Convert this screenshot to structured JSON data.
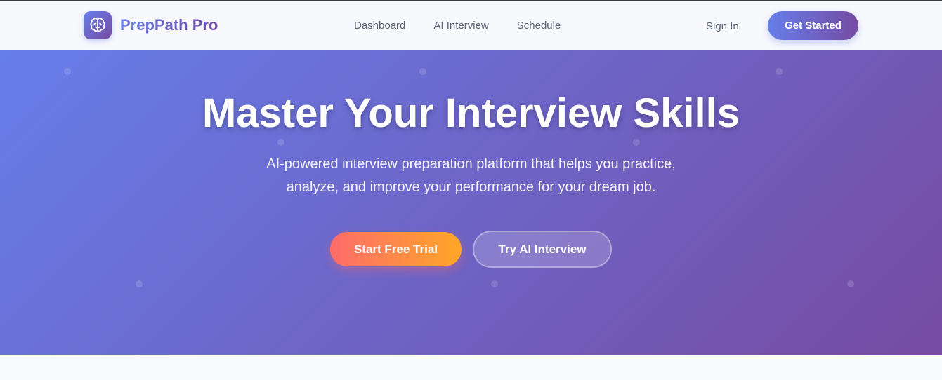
{
  "header": {
    "brand_name": "PrepPath Pro",
    "logo_icon": "brain-icon",
    "nav": [
      {
        "label": "Dashboard"
      },
      {
        "label": "AI Interview"
      },
      {
        "label": "Schedule"
      }
    ],
    "sign_in_label": "Sign In",
    "get_started_label": "Get Started"
  },
  "hero": {
    "title": "Master Your Interview Skills",
    "subtitle": "AI-powered interview preparation platform that helps you practice, analyze, and improve your performance for your dream job.",
    "primary_cta": "Start Free Trial",
    "secondary_cta": "Try AI Interview"
  },
  "colors": {
    "brand_start": "#667eea",
    "brand_end": "#764ba2",
    "cta_start": "#ff6b6b",
    "cta_end": "#ffa726"
  }
}
